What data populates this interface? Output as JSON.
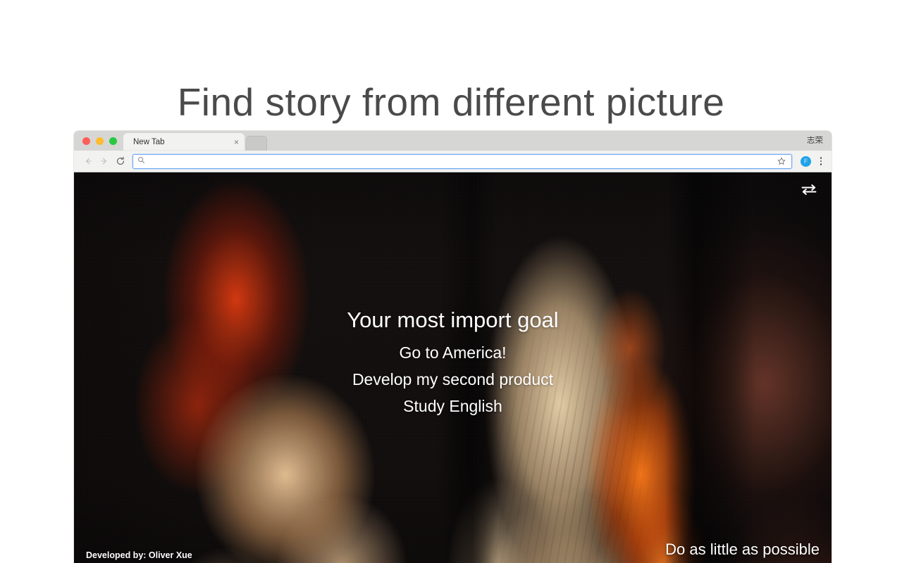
{
  "page": {
    "heading": "Find story from different picture"
  },
  "browser": {
    "traffic_lights": {
      "close_color": "#ff5f57",
      "minimize_color": "#febc2e",
      "maximize_color": "#29c840"
    },
    "tabs": [
      {
        "title": "New Tab",
        "close_label": "×",
        "active": true
      }
    ],
    "profile_name": "志荣",
    "toolbar": {
      "back_label": "Back",
      "forward_label": "Forward",
      "reload_label": "Reload",
      "omnibox_value": "",
      "omnibox_placeholder": "",
      "search_icon": "search-icon",
      "bookmark_icon": "star-icon",
      "avatar_initial": "F",
      "avatar_color": "#1fa2e8",
      "menu_icon": "kebab-menu-icon"
    }
  },
  "newtab": {
    "swap_icon": "swap-arrows-icon",
    "goal_title": "Your most import goal",
    "goals": [
      "Go to America!",
      "Develop my second product",
      "Study English"
    ],
    "credit": "Developed by: Oliver Xue",
    "quote": "Do as little as possible"
  }
}
